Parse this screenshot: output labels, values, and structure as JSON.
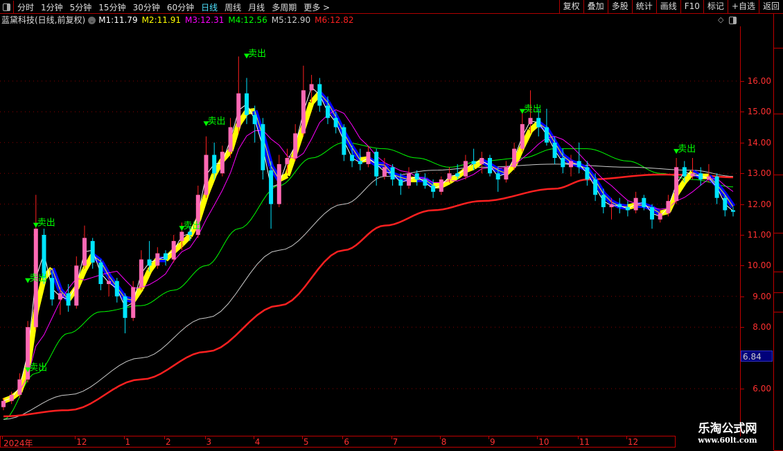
{
  "toolbar": {
    "periods": [
      "分时",
      "1分钟",
      "5分钟",
      "15分钟",
      "30分钟",
      "60分钟",
      "日线",
      "周线",
      "月线",
      "多周期",
      "更多 >"
    ],
    "active_period": "日线",
    "buttons": [
      "复权",
      "叠加",
      "多股",
      "统计",
      "画线",
      "F10",
      "标记",
      "+自选",
      "返回"
    ]
  },
  "info": {
    "stock": "蓝黛科技(日线,前复权)",
    "ma": [
      {
        "label": "M1:",
        "value": "11.79",
        "color": "#ffffff"
      },
      {
        "label": "M2:",
        "value": "11.91",
        "color": "#ffff00"
      },
      {
        "label": "M3:",
        "value": "12.31",
        "color": "#ff00ff"
      },
      {
        "label": "M4:",
        "value": "12.56",
        "color": "#00ff00"
      },
      {
        "label": "M5:",
        "value": "12.90",
        "color": "#cccccc"
      },
      {
        "label": "M6:",
        "value": "12.82",
        "color": "#ff2020"
      }
    ]
  },
  "price_tag": "6.84",
  "watermark": {
    "name": "乐淘公式网",
    "url": "www.60lt.com"
  },
  "chart_data": {
    "type": "candlestick",
    "y_ticks": [
      "16.00",
      "15.00",
      "14.00",
      "13.00",
      "12.00",
      "11.00",
      "10.00",
      "9.00",
      "8.00",
      "6.00"
    ],
    "ylim": [
      4.9,
      17.5
    ],
    "grid": "dotted horizontal",
    "colors": {
      "up": "#ff69b4",
      "down": "#00e5ff",
      "up_wick": "#ff2020",
      "band_up": "#ffff00",
      "band_down": "#0000ff",
      "signal": "#00ff00"
    },
    "x_labels": [
      {
        "index": 0,
        "label": "2024年"
      },
      {
        "index": 9,
        "label": "12"
      },
      {
        "index": 15,
        "label": "1"
      },
      {
        "index": 20,
        "label": "2"
      },
      {
        "index": 25,
        "label": "3"
      },
      {
        "index": 31,
        "label": "4"
      },
      {
        "index": 37,
        "label": "5"
      },
      {
        "index": 42,
        "label": "6"
      },
      {
        "index": 48,
        "label": "7"
      },
      {
        "index": 54,
        "label": "8"
      },
      {
        "index": 60,
        "label": "9"
      },
      {
        "index": 66,
        "label": "10"
      },
      {
        "index": 71,
        "label": "11"
      },
      {
        "index": 77,
        "label": "12"
      }
    ],
    "ohlc": [
      [
        5.4,
        5.7,
        5.3,
        5.6
      ],
      [
        5.6,
        5.9,
        5.5,
        5.8
      ],
      [
        5.8,
        6.5,
        5.7,
        6.3
      ],
      [
        6.3,
        8.2,
        6.2,
        8.0
      ],
      [
        8.0,
        12.3,
        7.9,
        11.2
      ],
      [
        11.0,
        11.2,
        9.4,
        9.6
      ],
      [
        9.6,
        9.8,
        8.7,
        8.9
      ],
      [
        8.9,
        9.3,
        8.4,
        9.1
      ],
      [
        9.1,
        9.4,
        8.5,
        8.7
      ],
      [
        8.7,
        10.3,
        8.6,
        10.0
      ],
      [
        10.0,
        11.3,
        9.9,
        10.9
      ],
      [
        10.8,
        10.9,
        9.9,
        10.1
      ],
      [
        10.1,
        10.2,
        9.2,
        9.4
      ],
      [
        9.4,
        9.7,
        9.0,
        9.5
      ],
      [
        9.5,
        9.6,
        8.8,
        9.0
      ],
      [
        9.0,
        9.1,
        7.8,
        8.3
      ],
      [
        8.3,
        9.5,
        8.2,
        9.3
      ],
      [
        9.3,
        10.5,
        9.2,
        10.2
      ],
      [
        10.2,
        10.8,
        9.8,
        10.0
      ],
      [
        10.0,
        10.6,
        9.9,
        10.4
      ],
      [
        10.4,
        10.5,
        10.0,
        10.2
      ],
      [
        10.2,
        11.0,
        10.1,
        10.8
      ],
      [
        10.8,
        11.4,
        10.5,
        11.1
      ],
      [
        11.1,
        11.3,
        10.8,
        11.0
      ],
      [
        11.0,
        12.6,
        10.9,
        12.3
      ],
      [
        12.3,
        14.2,
        12.2,
        13.6
      ],
      [
        13.6,
        14.0,
        12.8,
        13.0
      ],
      [
        13.0,
        13.9,
        12.9,
        13.7
      ],
      [
        13.7,
        14.8,
        13.5,
        14.5
      ],
      [
        14.5,
        16.8,
        14.3,
        15.6
      ],
      [
        15.6,
        16.1,
        14.6,
        14.9
      ],
      [
        14.9,
        15.2,
        14.0,
        14.6
      ],
      [
        14.6,
        14.8,
        12.8,
        13.1
      ],
      [
        13.1,
        13.4,
        11.2,
        12.0
      ],
      [
        12.0,
        13.6,
        11.9,
        13.3
      ],
      [
        13.3,
        13.8,
        13.0,
        13.5
      ],
      [
        13.5,
        14.6,
        13.4,
        14.3
      ],
      [
        14.3,
        16.5,
        14.2,
        15.7
      ],
      [
        15.7,
        16.2,
        15.3,
        15.9
      ],
      [
        15.9,
        16.1,
        15.0,
        15.2
      ],
      [
        15.2,
        15.5,
        14.6,
        14.8
      ],
      [
        14.8,
        15.0,
        14.3,
        14.5
      ],
      [
        14.5,
        14.6,
        13.4,
        13.6
      ],
      [
        13.6,
        13.9,
        13.2,
        13.4
      ],
      [
        13.4,
        13.8,
        13.1,
        13.3
      ],
      [
        13.3,
        13.9,
        13.2,
        13.7
      ],
      [
        13.7,
        13.8,
        12.6,
        12.9
      ],
      [
        12.9,
        13.5,
        12.8,
        13.2
      ],
      [
        13.2,
        13.3,
        12.6,
        12.8
      ],
      [
        12.8,
        13.0,
        12.3,
        12.6
      ],
      [
        12.6,
        13.2,
        12.5,
        13.0
      ],
      [
        13.0,
        13.1,
        12.6,
        12.8
      ],
      [
        12.8,
        13.0,
        12.5,
        12.6
      ],
      [
        12.6,
        12.8,
        12.2,
        12.4
      ],
      [
        12.4,
        12.9,
        12.3,
        12.8
      ],
      [
        12.8,
        13.2,
        12.7,
        13.0
      ],
      [
        13.0,
        13.3,
        12.8,
        12.9
      ],
      [
        12.9,
        13.6,
        12.8,
        13.4
      ],
      [
        13.4,
        13.8,
        13.1,
        13.3
      ],
      [
        13.3,
        13.7,
        13.0,
        13.5
      ],
      [
        13.5,
        13.6,
        12.9,
        13.0
      ],
      [
        13.0,
        13.2,
        12.4,
        12.8
      ],
      [
        12.8,
        13.4,
        12.7,
        13.2
      ],
      [
        13.2,
        14.0,
        13.1,
        13.8
      ],
      [
        13.8,
        15.0,
        13.7,
        14.6
      ],
      [
        14.6,
        15.7,
        14.3,
        14.8
      ],
      [
        14.8,
        15.1,
        14.2,
        14.5
      ],
      [
        14.5,
        15.1,
        13.9,
        14.0
      ],
      [
        14.0,
        14.2,
        13.3,
        13.5
      ],
      [
        13.5,
        13.8,
        13.0,
        13.2
      ],
      [
        13.2,
        13.6,
        12.9,
        13.4
      ],
      [
        13.4,
        14.0,
        13.0,
        13.2
      ],
      [
        13.2,
        13.4,
        12.6,
        12.8
      ],
      [
        12.8,
        13.0,
        12.1,
        12.3
      ],
      [
        12.3,
        12.5,
        11.7,
        11.9
      ],
      [
        11.9,
        12.2,
        11.5,
        12.0
      ],
      [
        12.0,
        12.2,
        11.7,
        11.9
      ],
      [
        11.9,
        12.1,
        11.6,
        11.8
      ],
      [
        11.8,
        12.4,
        11.7,
        12.2
      ],
      [
        12.2,
        12.3,
        11.8,
        11.9
      ],
      [
        11.9,
        12.0,
        11.2,
        11.5
      ],
      [
        11.5,
        11.8,
        11.4,
        11.7
      ],
      [
        11.7,
        12.3,
        11.6,
        12.1
      ],
      [
        12.1,
        13.5,
        12.0,
        13.2
      ],
      [
        13.2,
        13.4,
        12.7,
        12.9
      ],
      [
        12.9,
        13.5,
        12.8,
        13.0
      ],
      [
        13.0,
        13.2,
        12.6,
        12.8
      ],
      [
        12.8,
        13.3,
        12.7,
        12.9
      ],
      [
        12.9,
        13.0,
        12.0,
        12.2
      ],
      [
        12.2,
        12.3,
        11.6,
        11.8
      ],
      [
        11.8,
        11.9,
        11.6,
        11.75
      ]
    ],
    "series": [
      {
        "name": "M4",
        "color": "#00ff00",
        "points": [
          [
            0,
            5.0
          ],
          [
            4,
            6.5
          ],
          [
            8,
            7.8
          ],
          [
            12,
            8.5
          ],
          [
            17,
            8.7
          ],
          [
            21,
            9.2
          ],
          [
            25,
            10.0
          ],
          [
            29,
            11.2
          ],
          [
            34,
            12.6
          ],
          [
            38,
            13.5
          ],
          [
            42,
            14.0
          ],
          [
            47,
            13.8
          ],
          [
            51,
            13.5
          ],
          [
            55,
            13.2
          ],
          [
            59,
            13.4
          ],
          [
            64,
            13.5
          ],
          [
            68,
            13.8
          ],
          [
            72,
            13.8
          ],
          [
            77,
            13.4
          ],
          [
            81,
            13.0
          ],
          [
            85,
            12.8
          ],
          [
            90,
            12.56
          ]
        ]
      },
      {
        "name": "M5",
        "color": "#cccccc",
        "points": [
          [
            0,
            5.0
          ],
          [
            8,
            5.8
          ],
          [
            17,
            7.0
          ],
          [
            25,
            8.3
          ],
          [
            34,
            10.5
          ],
          [
            42,
            12.0
          ],
          [
            47,
            12.9
          ],
          [
            53,
            13.1
          ],
          [
            59,
            13.2
          ],
          [
            68,
            13.3
          ],
          [
            77,
            13.2
          ],
          [
            85,
            13.1
          ],
          [
            90,
            12.9
          ]
        ]
      },
      {
        "name": "M6",
        "color": "#ff2020",
        "points": [
          [
            0,
            5.1
          ],
          [
            8,
            5.3
          ],
          [
            17,
            6.3
          ],
          [
            25,
            7.2
          ],
          [
            34,
            8.7
          ],
          [
            42,
            10.5
          ],
          [
            47,
            11.3
          ],
          [
            53,
            11.8
          ],
          [
            59,
            12.1
          ],
          [
            68,
            12.5
          ],
          [
            72,
            12.8
          ],
          [
            81,
            12.96
          ],
          [
            85,
            12.95
          ],
          [
            90,
            12.87
          ]
        ]
      }
    ],
    "signals": [
      {
        "index": 4,
        "price": 11.3,
        "label": "卖出"
      },
      {
        "index": 3,
        "price": 9.5,
        "label": "卖出"
      },
      {
        "index": 3,
        "price": 6.6,
        "label": "卖出"
      },
      {
        "index": 22,
        "price": 11.2,
        "label": "卖出"
      },
      {
        "index": 25,
        "price": 14.6,
        "label": "卖出"
      },
      {
        "index": 30,
        "price": 16.8,
        "label": "卖出"
      },
      {
        "index": 64,
        "price": 15.0,
        "label": "卖出"
      },
      {
        "index": 83,
        "price": 13.7,
        "label": "卖出"
      }
    ]
  }
}
